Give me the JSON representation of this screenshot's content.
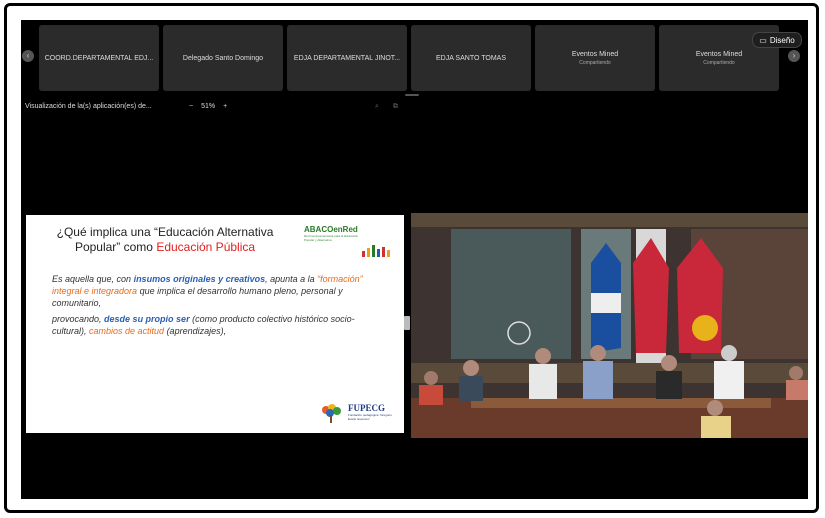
{
  "participants": [
    {
      "name": "COORD.DEPARTAMENTAL EDJ...",
      "sub": ""
    },
    {
      "name": "Delegado Santo Domingo",
      "sub": ""
    },
    {
      "name": "EDJA DEPARTAMENTAL JINOT...",
      "sub": ""
    },
    {
      "name": "EDJA SANTO TOMAS",
      "sub": ""
    },
    {
      "name": "Eventos Mined",
      "sub": "Compartiendo"
    },
    {
      "name": "Eventos Mined",
      "sub": "Compartiendo"
    }
  ],
  "toolbar": {
    "design_label": "Diseño",
    "design_icon": "layout-icon",
    "viz_label": "Visualización de la(s) aplicación(es) de...",
    "zoom_minus": "−",
    "zoom_value": "51%",
    "zoom_plus": "+"
  },
  "slide": {
    "title_part1": "¿Qué implica una “Educación Alternativa Popular” como ",
    "title_part2": "Educación Pública",
    "logo_name": "ABACOenRed",
    "logo_tagline": "Red Centroamericana para la Educación Popular y Alternativa",
    "body": {
      "p1": "Es aquella que, con ",
      "p1b": "insumos originales y creativos",
      "p1c": ", apunta a la ",
      "p1d": "“formación” integral e integradora",
      "p1e": " que implica el desarrollo humano pleno, personal y comunitario,",
      "p2": "provocando, ",
      "p2b": "desde su propio ser",
      "p2c": " (como producto colectivo histórico socio-cultural), ",
      "p2d": "cambios de actitud",
      "p2e": " (aprendizajes),"
    },
    "footer_logo_name": "FUPECG",
    "footer_logo_tagline": "Fundación pedagógica “Gregorio Evelio Guerrero”"
  },
  "colors": {
    "screen_bg": "#000000",
    "tile_bg": "#2b2b2b",
    "accent_red": "#e02020",
    "accent_blue": "#2a5fb5",
    "accent_orange": "#e86a1a"
  }
}
